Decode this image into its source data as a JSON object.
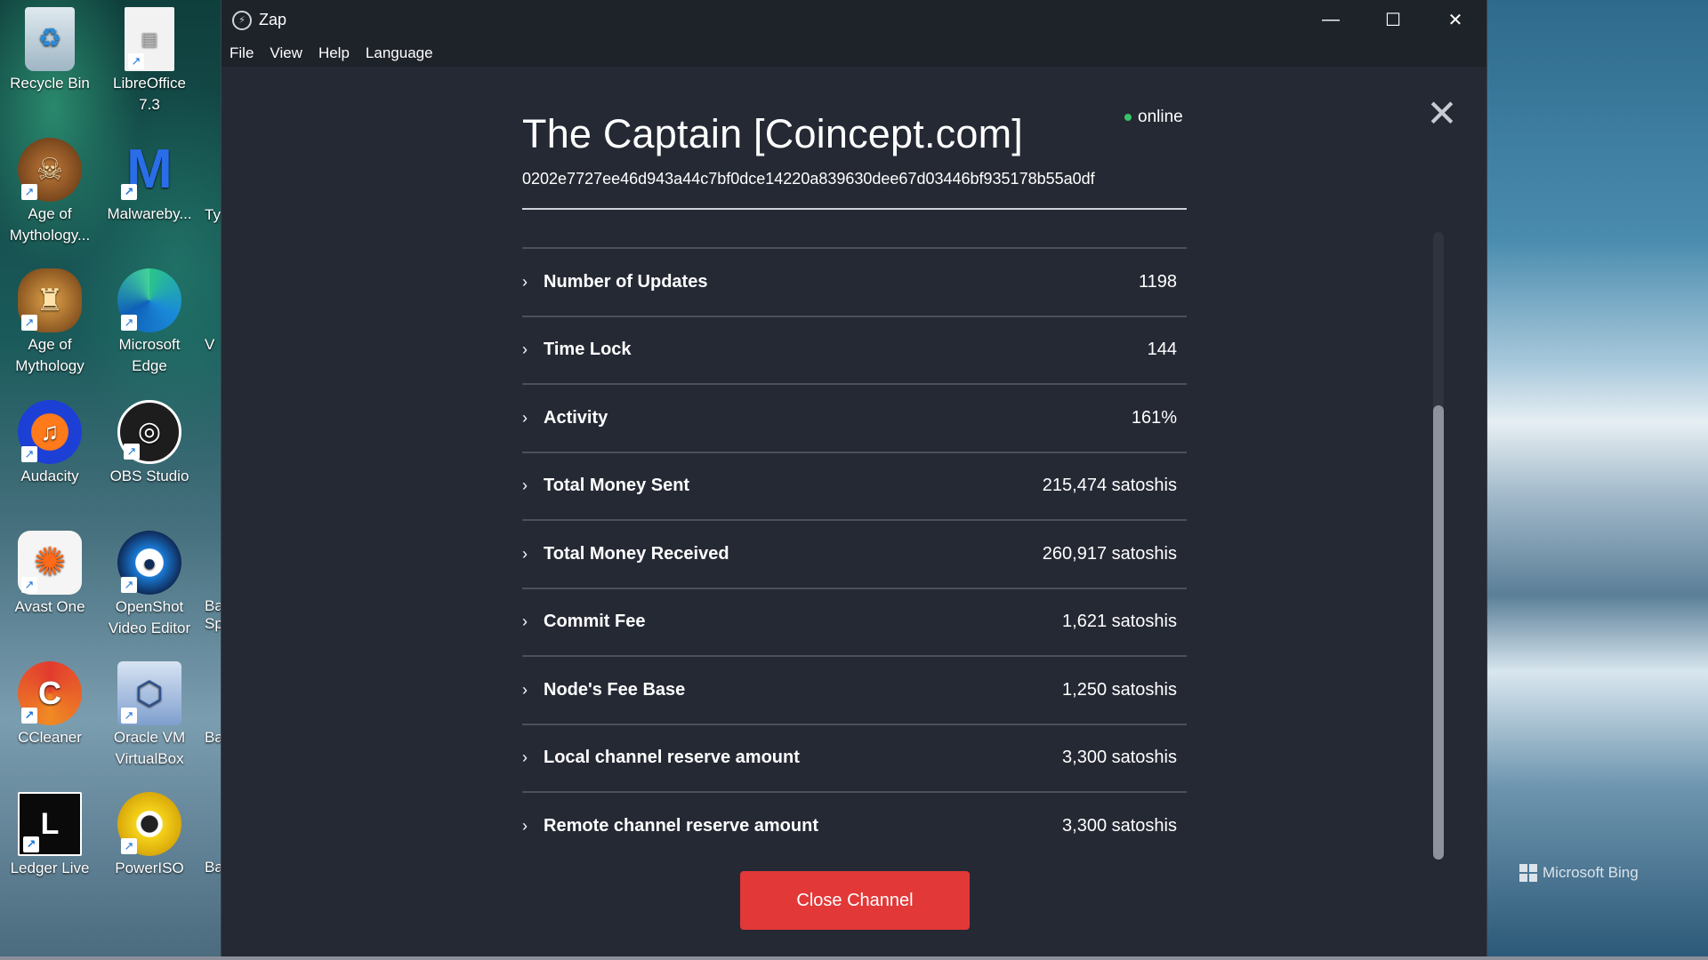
{
  "desktop": {
    "icons": [
      {
        "label": "Recycle Bin",
        "icon": "recycle-bin-icon"
      },
      {
        "label": "LibreOffice 7.3",
        "icon": "libreoffice-icon"
      },
      {
        "label": "Age of Mythology...",
        "icon": "age-of-mythology-icon"
      },
      {
        "label": "Malwareby...",
        "icon": "malwarebytes-icon"
      },
      {
        "label": "Age of Mythology",
        "icon": "age-of-mythology-icon"
      },
      {
        "label": "Microsoft Edge",
        "icon": "edge-icon"
      },
      {
        "label": "Audacity",
        "icon": "audacity-icon"
      },
      {
        "label": "OBS Studio",
        "icon": "obs-icon"
      },
      {
        "label": "Avast One",
        "icon": "avast-icon"
      },
      {
        "label": "OpenShot Video Editor",
        "icon": "openshot-icon"
      },
      {
        "label": "CCleaner",
        "icon": "ccleaner-icon"
      },
      {
        "label": "Oracle VM VirtualBox",
        "icon": "virtualbox-icon"
      },
      {
        "label": "Ledger Live",
        "icon": "ledger-icon"
      },
      {
        "label": "PowerISO",
        "icon": "poweriso-icon"
      }
    ],
    "clipped": [
      "Typ",
      "V",
      "Ba Sp",
      "Ba",
      "Ba"
    ],
    "wallpaper_credit": "Microsoft Bing"
  },
  "window": {
    "title": "Zap",
    "menu": [
      "File",
      "View",
      "Help",
      "Language"
    ]
  },
  "channel": {
    "name": "The Captain [Coincept.com]",
    "pubkey": "0202e7727ee46d943a44c7bf0dce14220a839630dee67d03446bf935178b55a0df",
    "status": "online",
    "status_color": "#35c46a",
    "rows": [
      {
        "label": "Number of Updates",
        "value": "1198"
      },
      {
        "label": "Time Lock",
        "value": "144"
      },
      {
        "label": "Activity",
        "value": "161%"
      },
      {
        "label": "Total Money Sent",
        "value": "215,474 satoshis"
      },
      {
        "label": "Total Money Received",
        "value": "260,917 satoshis"
      },
      {
        "label": "Commit Fee",
        "value": "1,621 satoshis"
      },
      {
        "label": "Node's Fee Base",
        "value": "1,250 satoshis"
      },
      {
        "label": "Local channel reserve amount",
        "value": "3,300 satoshis"
      },
      {
        "label": "Remote channel reserve amount",
        "value": "3,300 satoshis"
      }
    ],
    "close_button": "Close Channel",
    "close_button_color": "#e23838"
  }
}
